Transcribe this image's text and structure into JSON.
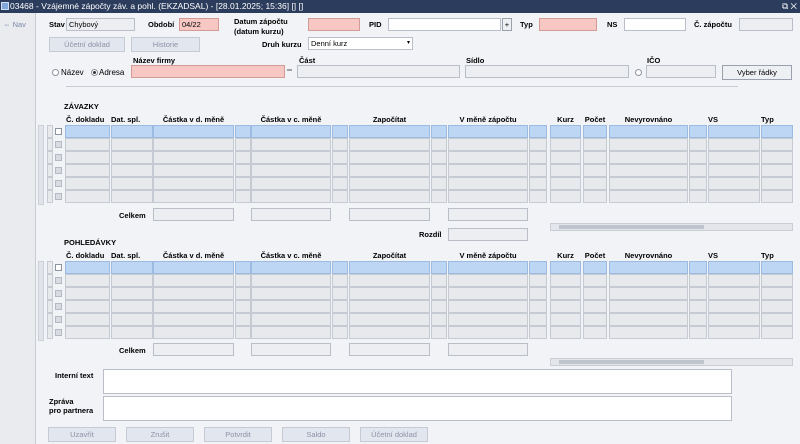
{
  "window": {
    "title": "03468 - Vzájemné zápočty záv. a pohl. (EKZADSAL) - [28.01.2025; 15:36] [] []",
    "controls": "⧉ ✕"
  },
  "nav": {
    "label": "Nav"
  },
  "header": {
    "stav_label": "Stav",
    "stav_value": "Chybový",
    "obdobi_label": "Období",
    "obdobi_value": "04/22",
    "datum_label_1": "Datum zápočtu",
    "datum_label_2": "(datum kurzu)",
    "datum_value": "",
    "pid_label": "PID",
    "pid_value": "",
    "typ_label": "Typ",
    "typ_value": "",
    "ns_label": "NS",
    "ns_value": "",
    "c_zapoctu_label": "Č. zápočtu",
    "c_zapoctu_value": "",
    "ucetni_doklad_button": "Účetní doklad",
    "historie_button": "Historie",
    "druh_kurzu_label": "Druh kurzu",
    "druh_kurzu_value": "Denní kurz",
    "nazev_firmy_label": "Název firmy",
    "cast_label": "Část",
    "sidlo_label": "Sídlo",
    "ico_label": "IČO",
    "radio_nazev": "Název",
    "radio_adresa": "Adresa",
    "vyber_radky_button": "Vyber řádky"
  },
  "zavazky": {
    "title": "ZÁVAZKY",
    "columns": [
      "Č. dokladu",
      "Dat. spl.",
      "Částka v d. měně",
      "Částka v c. měně",
      "Započítat",
      "V měně zápočtu",
      "Kurz",
      "Počet",
      "Nevyrovnáno",
      "VS",
      "Typ"
    ],
    "celkem_label": "Celkem",
    "rozdil_label": "Rozdíl"
  },
  "pohledavky": {
    "title": "POHLEDÁVKY",
    "columns": [
      "Č. dokladu",
      "Dat. spl.",
      "Částka v d. měně",
      "Částka v c. měně",
      "Započítat",
      "V měně zápočtu",
      "Kurz",
      "Počet",
      "Nevyrovnáno",
      "VS",
      "Typ"
    ],
    "celkem_label": "Celkem"
  },
  "footer": {
    "interni_text_label": "Interní text",
    "zprava_label_1": "Zpráva",
    "zprava_label_2": "pro partnera",
    "buttons": [
      "Uzavřít",
      "Zrušit",
      "Potvrdit",
      "Saldo",
      "Účetní doklad"
    ]
  }
}
